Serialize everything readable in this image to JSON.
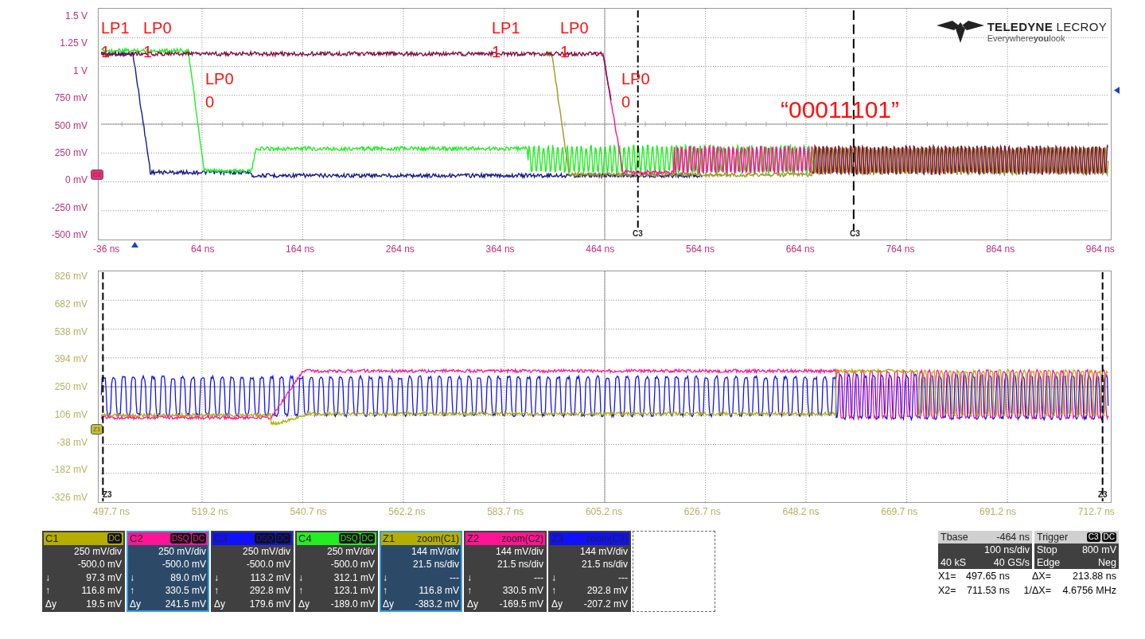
{
  "top_plot": {
    "y_labels": [
      "1.5 V",
      "1.25 V",
      "1 V",
      "750 mV",
      "500 mV",
      "250 mV",
      "0 mV",
      "-250 mV",
      "-500 mV"
    ],
    "x_labels": [
      "-36 ns",
      "64 ns",
      "164 ns",
      "264 ns",
      "364 ns",
      "464 ns",
      "564 ns",
      "664 ns",
      "764 ns",
      "864 ns",
      "964 ns"
    ],
    "ground_marker": "C2",
    "cursor_labels": [
      "C3",
      "C3"
    ],
    "annotations": [
      {
        "text": "LP1"
      },
      {
        "text": "1"
      },
      {
        "text": "LP0"
      },
      {
        "text": "1"
      },
      {
        "text": "LP0"
      },
      {
        "text": "0"
      },
      {
        "text": "LP1"
      },
      {
        "text": "1"
      },
      {
        "text": "LP0"
      },
      {
        "text": "1"
      },
      {
        "text": "LP0"
      },
      {
        "text": "0"
      },
      {
        "text": "“00011101”"
      }
    ],
    "logo": {
      "name": "**TELEDYNE** LECROY",
      "tagline": "Everywhere**you**look"
    }
  },
  "bottom_plot": {
    "y_labels": [
      "826 mV",
      "682 mV",
      "538 mV",
      "394 mV",
      "250 mV",
      "106 mV",
      "-38 mV",
      "-182 mV",
      "-326 mV"
    ],
    "x_labels": [
      "497.7 ns",
      "519.2 ns",
      "540.7 ns",
      "562.2 ns",
      "583.7 ns",
      "605.2 ns",
      "626.7 ns",
      "648.2 ns",
      "669.7 ns",
      "691.2 ns",
      "712.7 ns"
    ],
    "ground_marker": "Z1",
    "cursor_labels": [
      "Z3",
      "Z3"
    ]
  },
  "channels": [
    {
      "label": "C1",
      "color": "#b5ad00",
      "badges": [
        "DC"
      ],
      "selected": false,
      "rows": [
        {
          "symbol": "",
          "value": "250 mV/div"
        },
        {
          "symbol": "",
          "value": "-500.0 mV"
        },
        {
          "symbol": "↓",
          "value": "97.3 mV"
        },
        {
          "symbol": "↑",
          "value": "116.8 mV"
        },
        {
          "symbol": "Δy",
          "value": "19.5 mV"
        }
      ]
    },
    {
      "label": "C2",
      "color": "#ff1493",
      "badges": [
        "DSQ",
        "DC"
      ],
      "selected": true,
      "rows": [
        {
          "symbol": "",
          "value": "250 mV/div"
        },
        {
          "symbol": "",
          "value": "-500.0 mV"
        },
        {
          "symbol": "↓",
          "value": "89.0 mV"
        },
        {
          "symbol": "↑",
          "value": "330.5 mV"
        },
        {
          "symbol": "Δy",
          "value": "241.5 mV"
        }
      ]
    },
    {
      "label": "C3",
      "color": "#1010ff",
      "badges": [
        "DSQ",
        "DC"
      ],
      "selected": false,
      "rows": [
        {
          "symbol": "",
          "value": "250 mV/div"
        },
        {
          "symbol": "",
          "value": "-500.0 mV"
        },
        {
          "symbol": "↓",
          "value": "113.2 mV"
        },
        {
          "symbol": "↑",
          "value": "292.8 mV"
        },
        {
          "symbol": "Δy",
          "value": "179.6 mV"
        }
      ]
    },
    {
      "label": "C4",
      "color": "#22ee22",
      "badges": [
        "DSQ",
        "DC"
      ],
      "selected": false,
      "rows": [
        {
          "symbol": "",
          "value": "250 mV/div"
        },
        {
          "symbol": "",
          "value": "-500.0 mV"
        },
        {
          "symbol": "↓",
          "value": "312.1 mV"
        },
        {
          "symbol": "↑",
          "value": "123.1 mV"
        },
        {
          "symbol": "Δy",
          "value": "-189.0 mV"
        }
      ]
    },
    {
      "label": "Z1",
      "color": "#b5ad00",
      "source": "zoom(C1)",
      "selected": true,
      "rows": [
        {
          "symbol": "",
          "value": "144 mV/div"
        },
        {
          "symbol": "",
          "value": "21.5 ns/div"
        },
        {
          "symbol": "↓",
          "value": "---"
        },
        {
          "symbol": "↑",
          "value": "116.8 mV"
        },
        {
          "symbol": "Δy",
          "value": "-383.2 mV"
        }
      ]
    },
    {
      "label": "Z2",
      "color": "#ff1493",
      "source": "zoom(C2)",
      "selected": false,
      "rows": [
        {
          "symbol": "",
          "value": "144 mV/div"
        },
        {
          "symbol": "",
          "value": "21.5 ns/div"
        },
        {
          "symbol": "↓",
          "value": "---"
        },
        {
          "symbol": "↑",
          "value": "330.5 mV"
        },
        {
          "symbol": "Δy",
          "value": "-169.5 mV"
        }
      ]
    },
    {
      "label": "Z3",
      "color": "#1010ff",
      "source": "zoom(C3)",
      "selected": false,
      "rows": [
        {
          "symbol": "",
          "value": "144 mV/div"
        },
        {
          "symbol": "",
          "value": "21.5 ns/div"
        },
        {
          "symbol": "↓",
          "value": "---"
        },
        {
          "symbol": "↑",
          "value": "292.8 mV"
        },
        {
          "symbol": "Δy",
          "value": "-207.2 mV"
        }
      ]
    }
  ],
  "timebase": {
    "label": "Tbase",
    "offset": "-464 ns",
    "rows": [
      [
        "",
        "100 ns/div"
      ],
      [
        "40 kS",
        "40 GS/s"
      ]
    ]
  },
  "trigger": {
    "label": "Trigger",
    "badges": [
      "C3",
      "DC"
    ],
    "rows": [
      [
        "Stop",
        "800 mV"
      ],
      [
        "Edge",
        "Neg"
      ]
    ]
  },
  "cursors": [
    [
      "X1=",
      "497.65 ns",
      "ΔX=",
      "213.88 ns"
    ],
    [
      "X2=",
      "711.53 ns",
      "1/ΔX=",
      "4.6756 MHz"
    ]
  ]
}
